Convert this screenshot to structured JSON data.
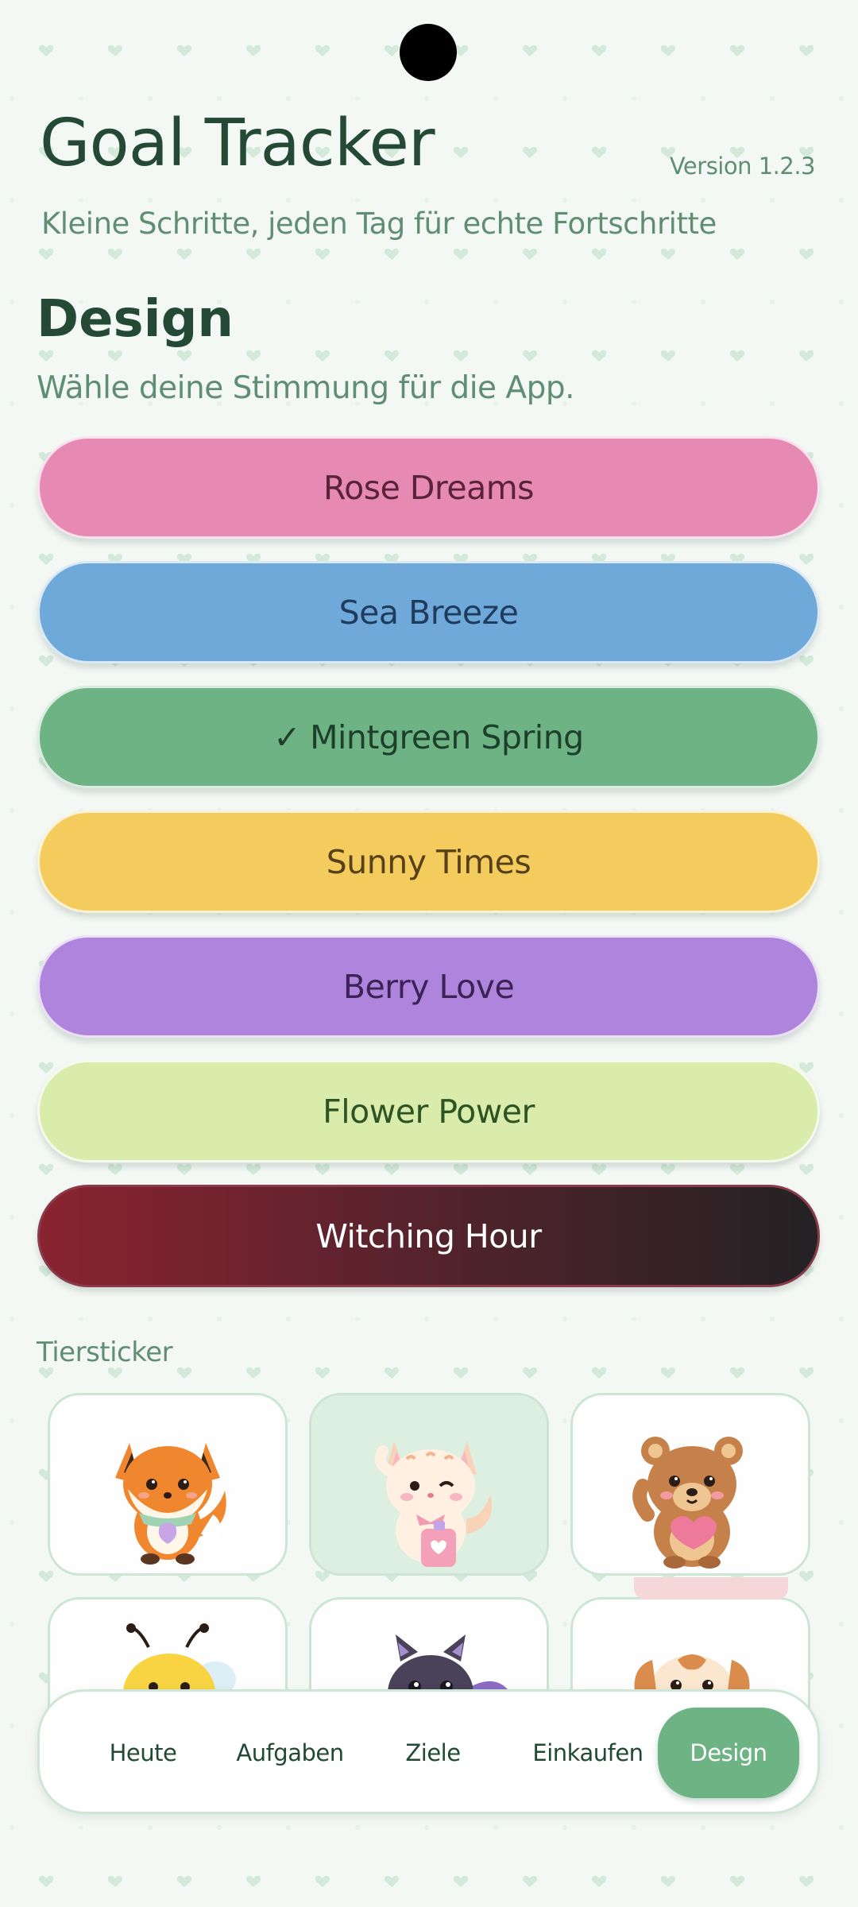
{
  "header": {
    "title": "Goal Tracker",
    "version": "Version 1.2.3",
    "subtitle": "Kleine Schritte, jeden Tag für echte Fortschritte"
  },
  "design_section": {
    "title": "Design",
    "subtitle": "Wähle deine Stimmung für die App.",
    "themes": [
      {
        "label": "Rose Dreams",
        "selected": false,
        "color": "#e78ab3"
      },
      {
        "label": "Sea Breeze",
        "selected": false,
        "color": "#6fa9da"
      },
      {
        "label": "Mintgreen Spring",
        "selected": true,
        "check": "✓",
        "color": "#6db384"
      },
      {
        "label": "Sunny Times",
        "selected": false,
        "color": "#f4cc5e"
      },
      {
        "label": "Berry Love",
        "selected": false,
        "color": "#af84dc"
      },
      {
        "label": "Flower Power",
        "selected": false,
        "color": "#d9ecab"
      },
      {
        "label": "Witching Hour",
        "selected": false,
        "color": "#8a2330"
      }
    ]
  },
  "stickers": {
    "label": "Tiersticker",
    "items": [
      {
        "icon": "fox-sticker-icon",
        "selected": false
      },
      {
        "icon": "cat-sticker-icon",
        "selected": true
      },
      {
        "icon": "bear-sticker-icon",
        "selected": false
      },
      {
        "icon": "bee-sticker-icon",
        "selected": false
      },
      {
        "icon": "bat-sticker-icon",
        "selected": false
      },
      {
        "icon": "puppy-sticker-icon",
        "selected": false
      }
    ]
  },
  "bottom_nav": {
    "items": [
      {
        "label": "Heute",
        "active": false
      },
      {
        "label": "Aufgaben",
        "active": false
      },
      {
        "label": "Ziele",
        "active": false
      },
      {
        "label": "Einkaufen",
        "active": false
      },
      {
        "label": "Design",
        "active": true
      }
    ]
  },
  "colors": {
    "accent": "#6db384",
    "background": "#f4f8f5",
    "heading": "#244a35",
    "muted_text": "#5f8e72"
  }
}
